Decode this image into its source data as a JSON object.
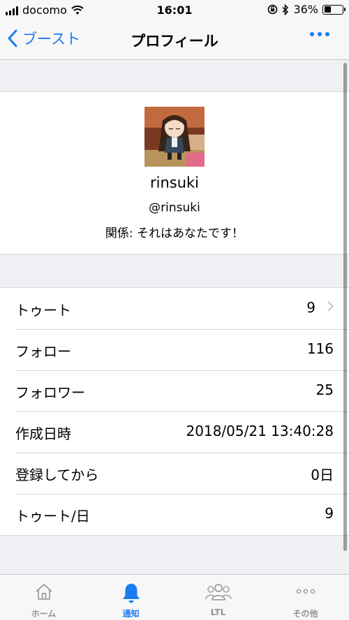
{
  "status_bar": {
    "carrier": "docomo",
    "time": "16:01",
    "battery_percent_label": "36%",
    "battery_level": 0.36
  },
  "nav": {
    "back_label": "ブースト",
    "title": "プロフィール",
    "more_icon": "ellipsis-icon"
  },
  "profile": {
    "display_name": "rinsuki",
    "username": "@rinsuki",
    "relationship": "関係: それはあなたです！"
  },
  "stats": [
    {
      "label": "トゥート",
      "value": "9"
    },
    {
      "label": "フォロー",
      "value": "116"
    },
    {
      "label": "フォロワー",
      "value": "25"
    },
    {
      "label": "作成日時",
      "value": "2018/05/21 13:40:28"
    },
    {
      "label": "登録してから",
      "value": "0日"
    },
    {
      "label": "トゥート/日",
      "value": "9"
    }
  ],
  "tabs": [
    {
      "label": "ホーム",
      "icon": "home-icon"
    },
    {
      "label": "通知",
      "icon": "bell-icon"
    },
    {
      "label": "LTL",
      "icon": "people-icon"
    },
    {
      "label": "その他",
      "icon": "more-icon"
    }
  ],
  "colors": {
    "accent": "#1a7cf5",
    "inactive_tab": "#929292",
    "background": "#efeff4"
  }
}
